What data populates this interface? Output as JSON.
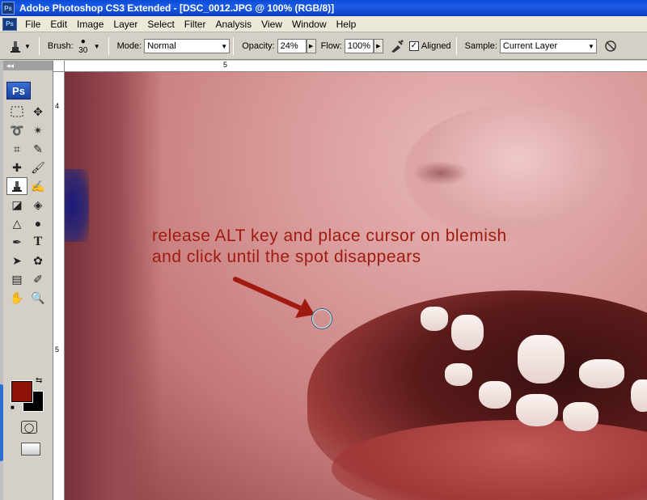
{
  "window": {
    "title": "Adobe Photoshop CS3 Extended - [DSC_0012.JPG @ 100% (RGB/8)]",
    "app_badge": "Ps"
  },
  "menubar": {
    "items": [
      "File",
      "Edit",
      "Image",
      "Layer",
      "Select",
      "Filter",
      "Analysis",
      "View",
      "Window",
      "Help"
    ]
  },
  "options": {
    "brush_label": "Brush:",
    "brush_size": "30",
    "mode_label": "Mode:",
    "mode_value": "Normal",
    "opacity_label": "Opacity:",
    "opacity_value": "24%",
    "flow_label": "Flow:",
    "flow_value": "100%",
    "aligned_label": "Aligned",
    "aligned_checked": true,
    "sample_label": "Sample:",
    "sample_value": "Current Layer"
  },
  "toolbox": {
    "header": "◂◂",
    "logo": "Ps",
    "foreground_color": "#8e1208",
    "background_color": "#000000"
  },
  "rulers": {
    "top_label": "5",
    "left_labels": [
      "4",
      "5"
    ]
  },
  "canvas": {
    "annotation_line1": "release ALT key and place cursor on blemish",
    "annotation_line2": "and click until the spot disappears",
    "annotation_color": "#a01a10"
  }
}
